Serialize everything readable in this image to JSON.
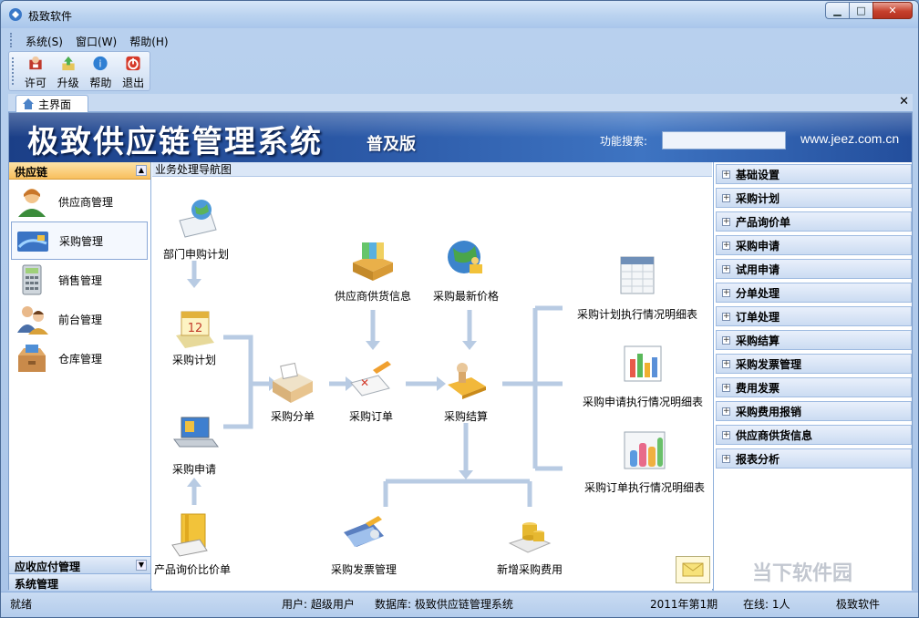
{
  "window": {
    "title": "极致软件"
  },
  "menu": [
    {
      "label": "系统(S)"
    },
    {
      "label": "窗口(W)"
    },
    {
      "label": "帮助(H)"
    }
  ],
  "toolbar": [
    {
      "label": "许可",
      "icon": "license-icon"
    },
    {
      "label": "升级",
      "icon": "upgrade-icon"
    },
    {
      "label": "帮助",
      "icon": "help-icon"
    },
    {
      "label": "退出",
      "icon": "power-icon"
    }
  ],
  "tab": {
    "label": "主界面"
  },
  "banner": {
    "title": "极致供应链管理系统",
    "edition": "普及版",
    "search_label": "功能搜索:",
    "search_value": "",
    "site": "www.jeez.com.cn"
  },
  "leftnav": {
    "active_group": "供应链",
    "items": [
      {
        "label": "供应商管理"
      },
      {
        "label": "采购管理"
      },
      {
        "label": "销售管理"
      },
      {
        "label": "前台管理"
      },
      {
        "label": "仓库管理"
      }
    ],
    "bottom_groups": [
      "应收应付管理",
      "系统管理"
    ]
  },
  "flow": {
    "header": "业务处理导航图",
    "nodes": {
      "dept_plan": "部门申购计划",
      "purchase_plan": "采购计划",
      "purchase_request": "采购申请",
      "price_compare": "产品询价比价单",
      "supplier_info": "供应商供货信息",
      "latest_price": "采购最新价格",
      "purchase_split": "采购分单",
      "purchase_order": "采购订单",
      "purchase_settle": "采购结算",
      "invoice_mgmt": "采购发票管理",
      "new_expense": "新增采购费用",
      "plan_report": "采购计划执行情况明细表",
      "request_report": "采购申请执行情况明细表",
      "order_report": "采购订单执行情况明细表"
    }
  },
  "rightpanel": [
    "基础设置",
    "采购计划",
    "产品询价单",
    "采购申请",
    "试用申请",
    "分单处理",
    "订单处理",
    "采购结算",
    "采购发票管理",
    "费用发票",
    "采购费用报销",
    "供应商供货信息",
    "报表分析"
  ],
  "status": {
    "ready": "就绪",
    "user": "用户: 超级用户",
    "database": "数据库: 极致供应链管理系统",
    "period": "2011年第1期",
    "online": "在线: 1人",
    "vendor": "极致软件"
  },
  "watermark": "当下软件园",
  "colors": {
    "banner": "#2c5aa8",
    "active_group": "#f8bf5e",
    "flow_line": "#b8cbe3"
  }
}
